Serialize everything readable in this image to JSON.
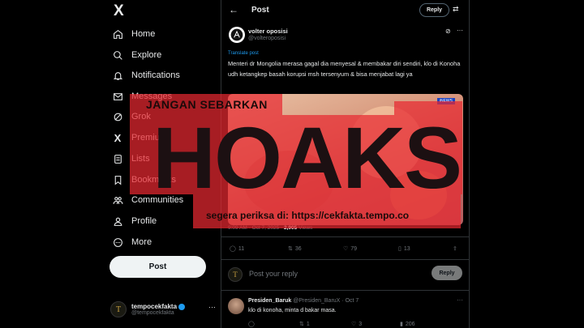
{
  "sidebar": {
    "logo": "X",
    "items": [
      {
        "label": "Home",
        "icon": "home-icon"
      },
      {
        "label": "Explore",
        "icon": "search-icon"
      },
      {
        "label": "Notifications",
        "icon": "bell-icon"
      },
      {
        "label": "Messages",
        "icon": "mail-icon"
      },
      {
        "label": "Grok",
        "icon": "grok-icon"
      },
      {
        "label": "Premium",
        "icon": "x-icon"
      },
      {
        "label": "Lists",
        "icon": "list-icon"
      },
      {
        "label": "Bookmarks",
        "icon": "bookmark-icon"
      },
      {
        "label": "Communities",
        "icon": "people-icon"
      },
      {
        "label": "Profile",
        "icon": "person-icon"
      },
      {
        "label": "More",
        "icon": "more-circle-icon"
      }
    ],
    "post_button": "Post",
    "account": {
      "name": "tempocekfakta",
      "handle": "@tempocekfakta",
      "avatar_letter": "T",
      "more": "···"
    }
  },
  "header": {
    "title": "Post",
    "reply_button": "Reply"
  },
  "tweet": {
    "author_name": "volter oposisi",
    "author_handle": "@volteroposisi",
    "translate": "Translate post",
    "text": "Menteri dr Mongolia merasa gagal dia menyesal & membakar diri sendiri, klo di Konoha udh ketangkep basah korupsi msh tersenyum & bisa menjabat lagi ya",
    "media_badge": "iNEWS",
    "timestamp": "9:09 AM · Oct 7, 2025 · ",
    "views": "2,905",
    "views_label": " Views",
    "stats": {
      "replies": "11",
      "reposts": "36",
      "likes": "79",
      "bookmarks": "13"
    }
  },
  "reply_box": {
    "placeholder": "Post your reply",
    "button": "Reply",
    "avatar_letter": "T"
  },
  "comment": {
    "name": "Presiden_Baruk",
    "handle": "@Presiden_BaruX · Oct 7",
    "text": "klo di konoha, minta d bakar masa.",
    "stats": {
      "replies": "",
      "reposts": "1",
      "likes": "3",
      "views": "206"
    }
  },
  "overlay": {
    "warning": "JANGAN SEBARKAN",
    "stamp": "HOAKS",
    "footer": "segera periksa di: https://cekfakta.tempo.co",
    "accent": "#e42a32"
  }
}
